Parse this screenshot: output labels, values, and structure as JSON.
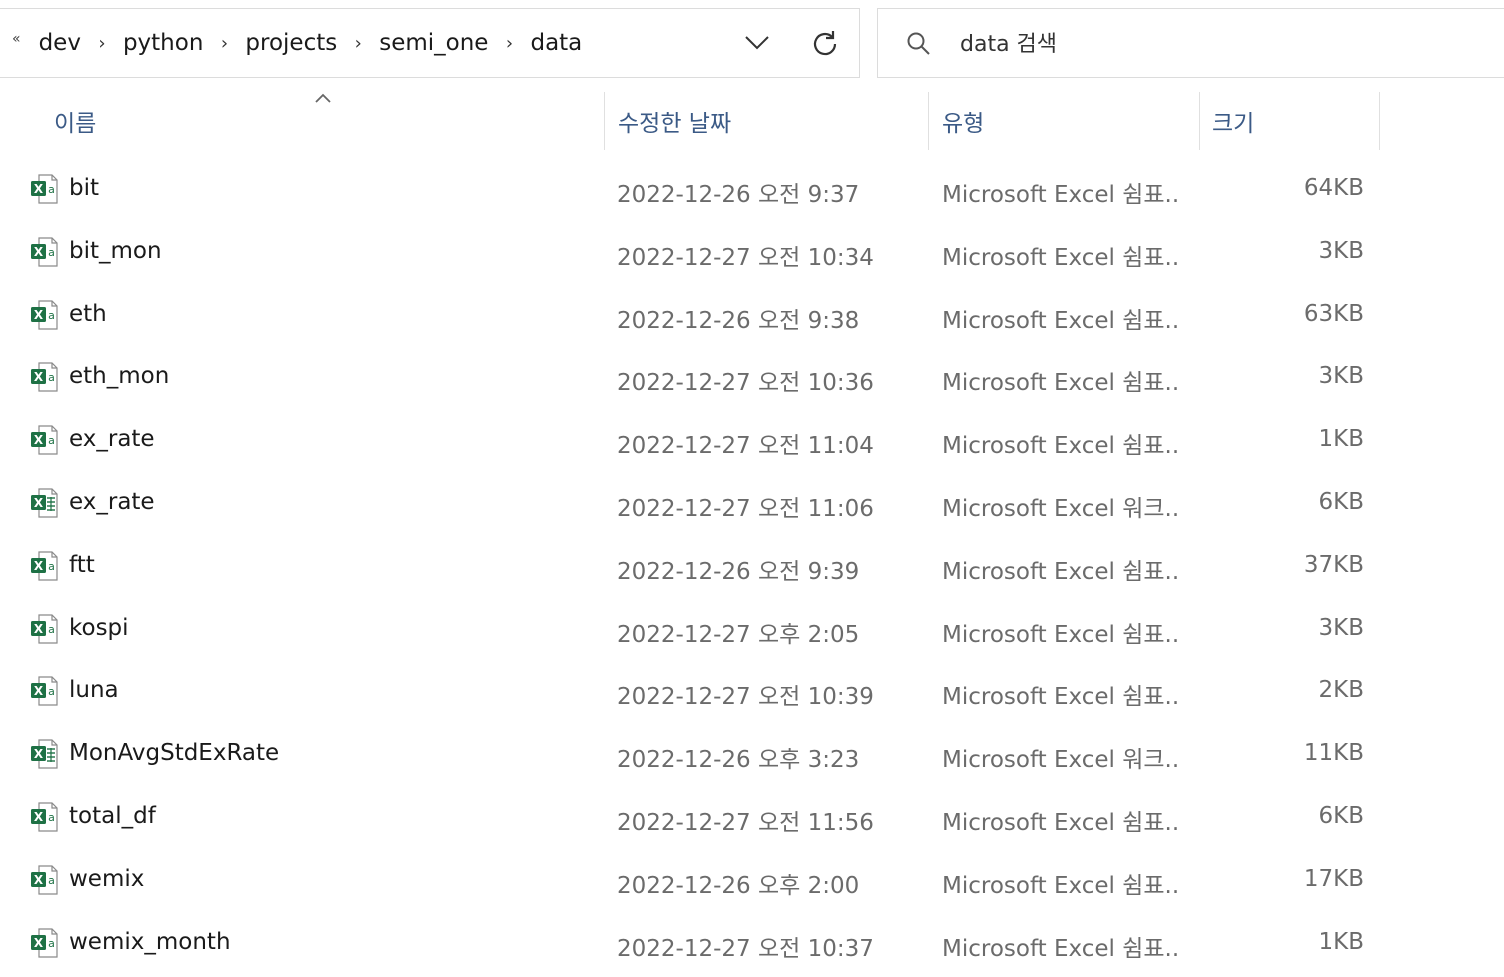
{
  "address_bar": {
    "overflow": "«",
    "crumbs": [
      "dev",
      "python",
      "projects",
      "semi_one",
      "data"
    ]
  },
  "search": {
    "placeholder": "data 검색"
  },
  "columns": {
    "name": "이름",
    "date": "수정한 날짜",
    "type": "유형",
    "size": "크기"
  },
  "colors": {
    "header_text": "#3b5a86",
    "excel_green": "#1e7145",
    "muted_text": "#6b6b6b"
  },
  "files": [
    {
      "name": "bit",
      "date": "2022-12-26 오전 9:37",
      "type": "Microsoft Excel 쉼표...",
      "size": "64KB",
      "icon": "excel-csv-icon"
    },
    {
      "name": "bit_mon",
      "date": "2022-12-27 오전 10:34",
      "type": "Microsoft Excel 쉼표...",
      "size": "3KB",
      "icon": "excel-csv-icon"
    },
    {
      "name": "eth",
      "date": "2022-12-26 오전 9:38",
      "type": "Microsoft Excel 쉼표...",
      "size": "63KB",
      "icon": "excel-csv-icon"
    },
    {
      "name": "eth_mon",
      "date": "2022-12-27 오전 10:36",
      "type": "Microsoft Excel 쉼표...",
      "size": "3KB",
      "icon": "excel-csv-icon"
    },
    {
      "name": "ex_rate",
      "date": "2022-12-27 오전 11:04",
      "type": "Microsoft Excel 쉼표...",
      "size": "1KB",
      "icon": "excel-csv-icon"
    },
    {
      "name": "ex_rate",
      "date": "2022-12-27 오전 11:06",
      "type": "Microsoft Excel 워크...",
      "size": "6KB",
      "icon": "excel-workbook-icon"
    },
    {
      "name": "ftt",
      "date": "2022-12-26 오전 9:39",
      "type": "Microsoft Excel 쉼표...",
      "size": "37KB",
      "icon": "excel-csv-icon"
    },
    {
      "name": "kospi",
      "date": "2022-12-27 오후 2:05",
      "type": "Microsoft Excel 쉼표...",
      "size": "3KB",
      "icon": "excel-csv-icon"
    },
    {
      "name": "luna",
      "date": "2022-12-27 오전 10:39",
      "type": "Microsoft Excel 쉼표...",
      "size": "2KB",
      "icon": "excel-csv-icon"
    },
    {
      "name": "MonAvgStdExRate",
      "date": "2022-12-26 오후 3:23",
      "type": "Microsoft Excel 워크...",
      "size": "11KB",
      "icon": "excel-workbook-icon"
    },
    {
      "name": "total_df",
      "date": "2022-12-27 오전 11:56",
      "type": "Microsoft Excel 쉼표...",
      "size": "6KB",
      "icon": "excel-csv-icon"
    },
    {
      "name": "wemix",
      "date": "2022-12-26 오후 2:00",
      "type": "Microsoft Excel 쉼표...",
      "size": "17KB",
      "icon": "excel-csv-icon"
    },
    {
      "name": "wemix_month",
      "date": "2022-12-27 오전 10:37",
      "type": "Microsoft Excel 쉼표...",
      "size": "1KB",
      "icon": "excel-csv-icon"
    }
  ]
}
